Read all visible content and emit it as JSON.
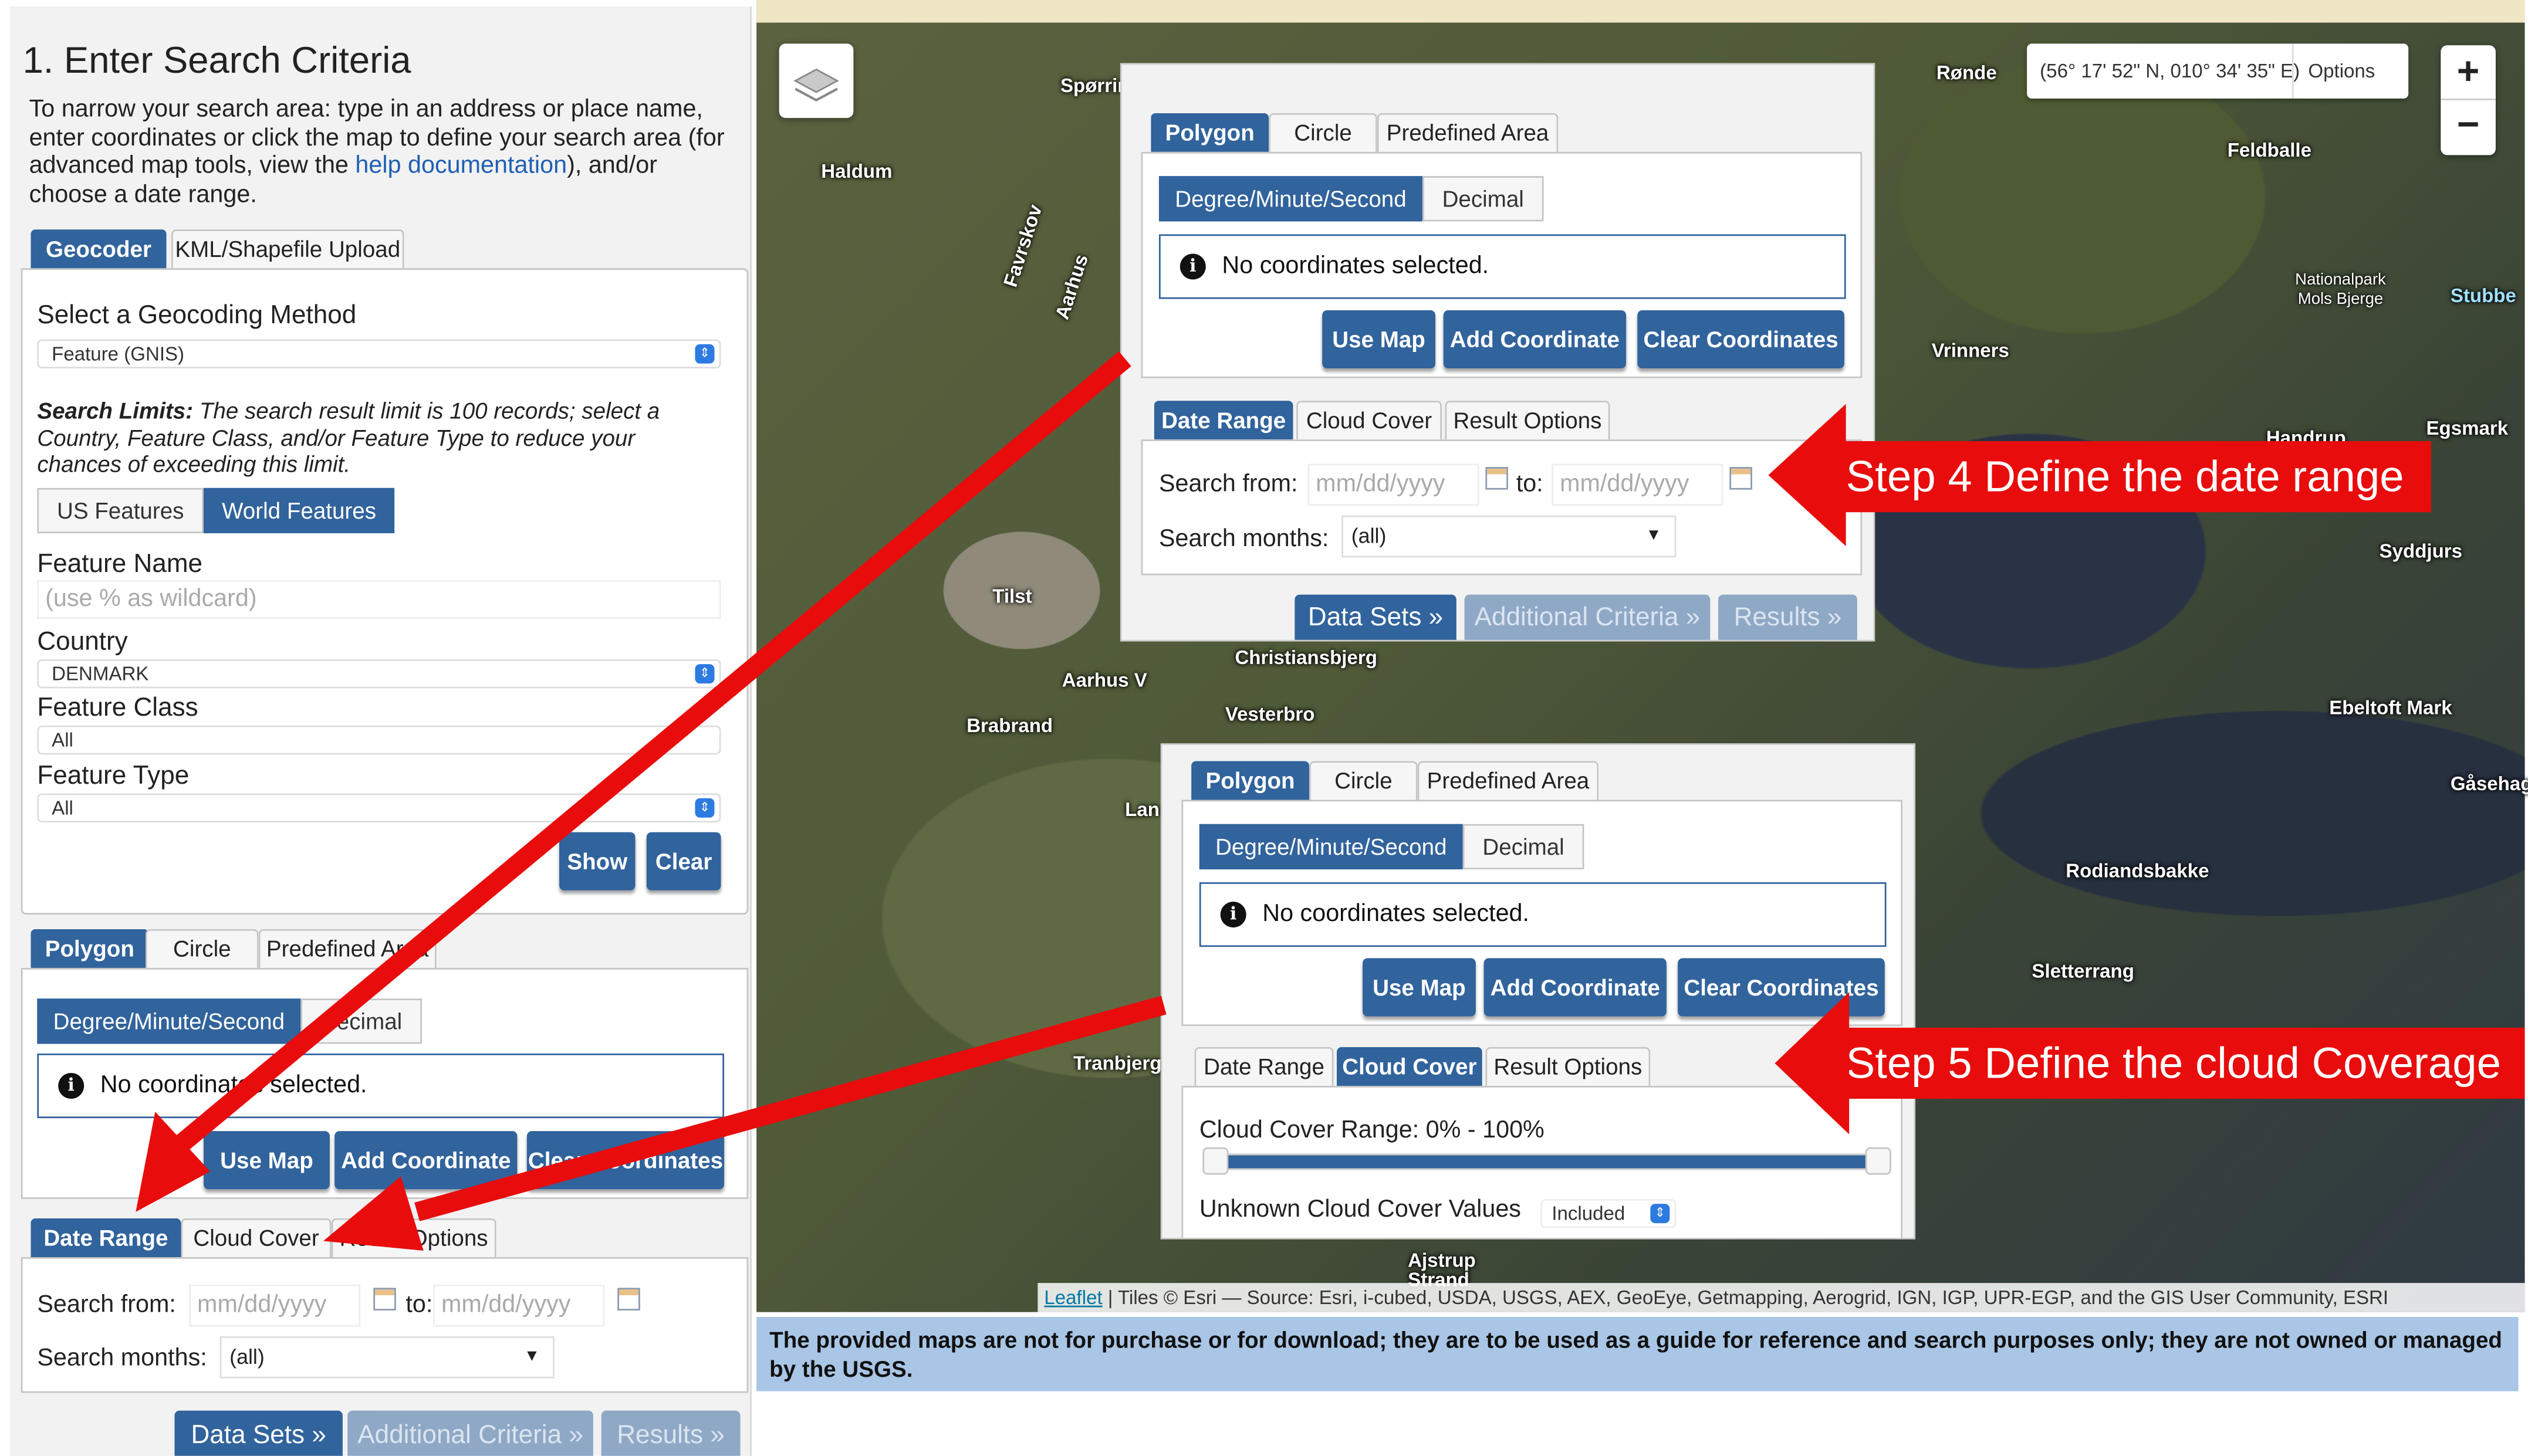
{
  "left_panel": {
    "title": "1. Enter Search Criteria",
    "intro_before": "To narrow your search area: type in an address or place name, enter coordinates or click the map to define your search area (for advanced map tools, view the ",
    "intro_link": "help documentation",
    "intro_after": "), and/or choose a date range.",
    "tabs": [
      "Geocoder",
      "KML/Shapefile Upload"
    ],
    "geocoding_label": "Select a Geocoding Method",
    "geocoding_value": "Feature (GNIS)",
    "limits_bold": "Search Limits:",
    "limits_text": " The search result limit is 100 records; select a Country, Feature Class, and/or Feature Type to reduce your chances of exceeding this limit.",
    "feature_toggle": [
      "US Features",
      "World Features"
    ],
    "feature_name_label": "Feature Name",
    "feature_name_placeholder": "(use % as wildcard)",
    "country_label": "Country",
    "country_value": "DENMARK",
    "feature_class_label": "Feature Class",
    "feature_class_value": "All",
    "feature_type_label": "Feature Type",
    "feature_type_value": "All",
    "show_button": "Show",
    "clear_button": "Clear",
    "area_tabs": [
      "Polygon",
      "Circle",
      "Predefined Area"
    ],
    "coord_modes": [
      "Degree/Minute/Second",
      "Decimal"
    ],
    "no_coords": "No coordinates selected.",
    "coord_buttons": [
      "Use Map",
      "Add Coordinate",
      "Clear Coordinates"
    ],
    "date_tabs": [
      "Date Range",
      "Cloud Cover",
      "Result Options"
    ],
    "search_from_label": "Search from:",
    "to_label": "to:",
    "date_placeholder": "mm/dd/yyyy",
    "search_months_label": "Search months:",
    "search_months_value": "(all)",
    "nav_buttons": [
      "Data Sets »",
      "Additional Criteria »",
      "Results »"
    ]
  },
  "map": {
    "coordinate_readout": "(56° 17' 52\" N, 010° 34' 35\" E)",
    "options_button": "Options",
    "zoom_in": "+",
    "zoom_out": "−",
    "attribution_link": "Leaflet",
    "attribution_text": " | Tiles © Esri — Source: Esri, i-cubed, USDA, USGS, AEX, GeoEye, Getmapping, Aerogrid, IGN, IGP, UPR-EGP, and the GIS User Community, ESRI",
    "disclaimer": "The provided maps are not for purchase or for download; they are to be used as a guide for reference and search purposes only; they are not owned or managed by the USGS.",
    "places": [
      "Rønde",
      "Feldballe",
      "Haldum",
      "Spørring",
      "Favrskov",
      "Aarhus",
      "Vrinners",
      "Nationalpark Mols Bjerge",
      "Stubbe",
      "Egsmark",
      "Handrup",
      "Syddjurs",
      "Tilst",
      "Christiansbjerg",
      "Aarhus V",
      "Vesterbro",
      "Brabrand",
      "Ebeltoft Mark",
      "Gåsehage",
      "Rodiandsbakke",
      "Lan",
      "Tranbjerg",
      "Sletterrang",
      "Ajstrup Strand"
    ]
  },
  "popup_date": {
    "area_tabs": [
      "Polygon",
      "Circle",
      "Predefined Area"
    ],
    "coord_modes": [
      "Degree/Minute/Second",
      "Decimal"
    ],
    "no_coords": "No coordinates selected.",
    "coord_buttons": [
      "Use Map",
      "Add Coordinate",
      "Clear Coordinates"
    ],
    "date_tabs": [
      "Date Range",
      "Cloud Cover",
      "Result Options"
    ],
    "search_from_label": "Search from:",
    "to_label": "to:",
    "date_placeholder": "mm/dd/yyyy",
    "search_months_label": "Search months:",
    "search_months_value": "(all)",
    "nav_buttons": [
      "Data Sets »",
      "Additional Criteria »",
      "Results »"
    ]
  },
  "popup_cloud": {
    "area_tabs": [
      "Polygon",
      "Circle",
      "Predefined Area"
    ],
    "coord_modes": [
      "Degree/Minute/Second",
      "Decimal"
    ],
    "no_coords": "No coordinates selected.",
    "coord_buttons": [
      "Use Map",
      "Add Coordinate",
      "Clear Coordinates"
    ],
    "date_tabs": [
      "Date Range",
      "Cloud Cover",
      "Result Options"
    ],
    "cloud_range_label": "Cloud Cover Range: 0% - 100%",
    "cloud_range_min": 0,
    "cloud_range_max": 100,
    "unknown_label": "Unknown Cloud Cover Values",
    "unknown_value": "Included"
  },
  "annotations": {
    "step4": "Step 4 Define the date range",
    "step5": "Step 5 Define the cloud Coverage"
  },
  "colors": {
    "accent": "#31639c",
    "annotation_red": "#e80c0c",
    "disclaimer_bg": "#a9c6e6"
  }
}
